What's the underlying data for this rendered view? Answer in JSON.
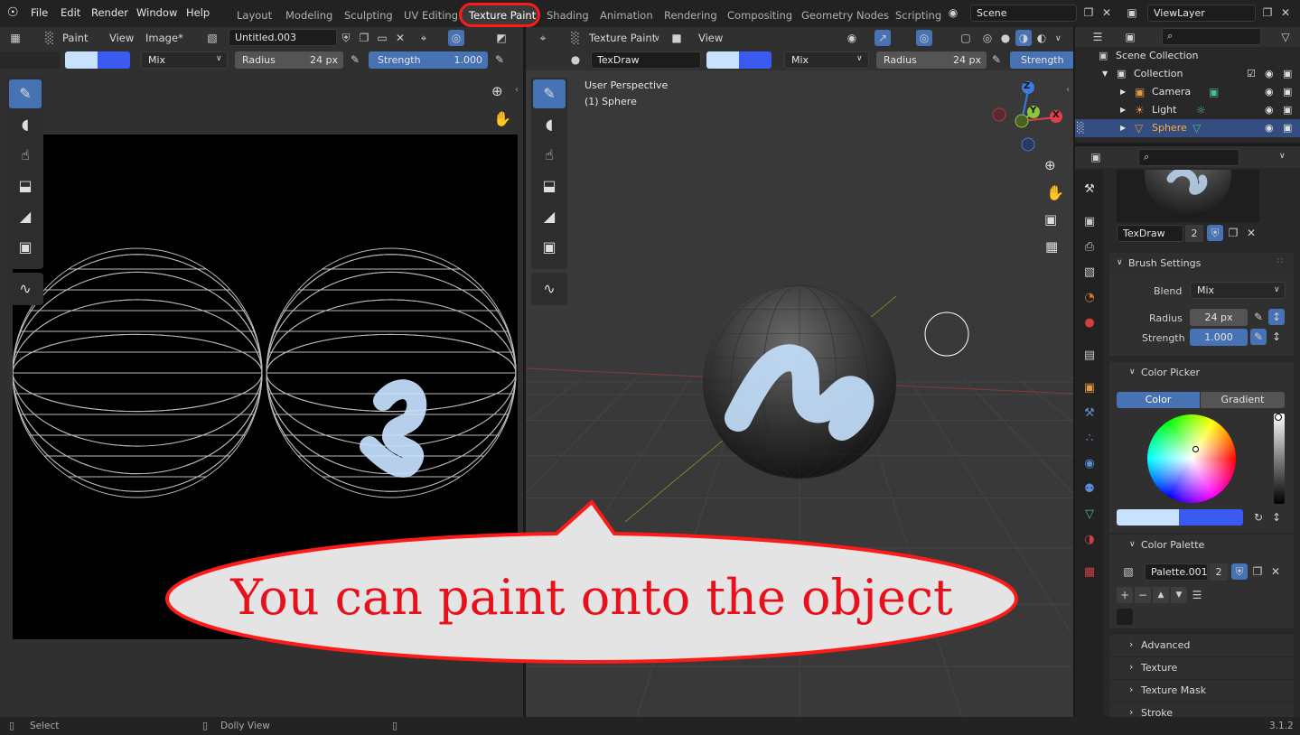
{
  "menu": {
    "items": [
      "File",
      "Edit",
      "Render",
      "Window",
      "Help"
    ]
  },
  "workspaces": {
    "tabs": [
      "Layout",
      "Modeling",
      "Sculpting",
      "UV Editing",
      "Texture Paint",
      "Shading",
      "Animation",
      "Rendering",
      "Compositing",
      "Geometry Nodes",
      "Scripting"
    ],
    "active": "Texture Paint"
  },
  "scene": {
    "name": "Scene"
  },
  "view_layer": {
    "name": "ViewLayer"
  },
  "image_editor": {
    "mode": "Paint",
    "menus": [
      "View",
      "Image*"
    ],
    "image_name": "Untitled.003",
    "blend": "Mix",
    "radius_label": "Radius",
    "radius_value": "24 px",
    "strength_label": "Strength",
    "strength_value": "1.000"
  },
  "viewport": {
    "mode": "Texture Paint",
    "menu": "View",
    "brush_name": "TexDraw",
    "blend": "Mix",
    "radius_label": "Radius",
    "radius_value": "24 px",
    "strength_label": "Strength",
    "perspective": "User Perspective",
    "object_info": "(1) Sphere",
    "gizmo": {
      "z": "Z",
      "y": "Y",
      "x": "X"
    }
  },
  "outliner": {
    "scene_collection": "Scene Collection",
    "collection": "Collection",
    "items": [
      "Camera",
      "Light",
      "Sphere"
    ]
  },
  "properties": {
    "brush_name": "TexDraw",
    "brush_users": "2",
    "brush_settings": "Brush Settings",
    "blend_label": "Blend",
    "blend_value": "Mix",
    "radius_label": "Radius",
    "radius_value": "24 px",
    "strength_label": "Strength",
    "strength_value": "1.000",
    "color_picker": "Color Picker",
    "color_tab": "Color",
    "gradient_tab": "Gradient",
    "color_palette": "Color Palette",
    "palette_name": "Palette.001",
    "palette_users": "2",
    "sections": [
      "Advanced",
      "Texture",
      "Texture Mask",
      "Stroke"
    ]
  },
  "statusbar": {
    "select": "Select",
    "dolly": "Dolly View",
    "version": "3.1.2"
  },
  "callout": {
    "text": "You can paint onto the object"
  },
  "colors": {
    "primary": "#c6e2ff",
    "secondary": "#3a5af2",
    "accent": "#4772b3",
    "highlight": "#ff1a1a",
    "callout_text": "#e8101a"
  },
  "icons": [
    "blender-logo",
    "brush-icon",
    "drop-icon",
    "smear-icon",
    "stamp-icon",
    "fill-icon",
    "mask-icon",
    "annotate-icon",
    "zoom-icon",
    "hand-icon",
    "camera-icon",
    "grid-icon",
    "eye-icon",
    "camera-render-icon"
  ]
}
